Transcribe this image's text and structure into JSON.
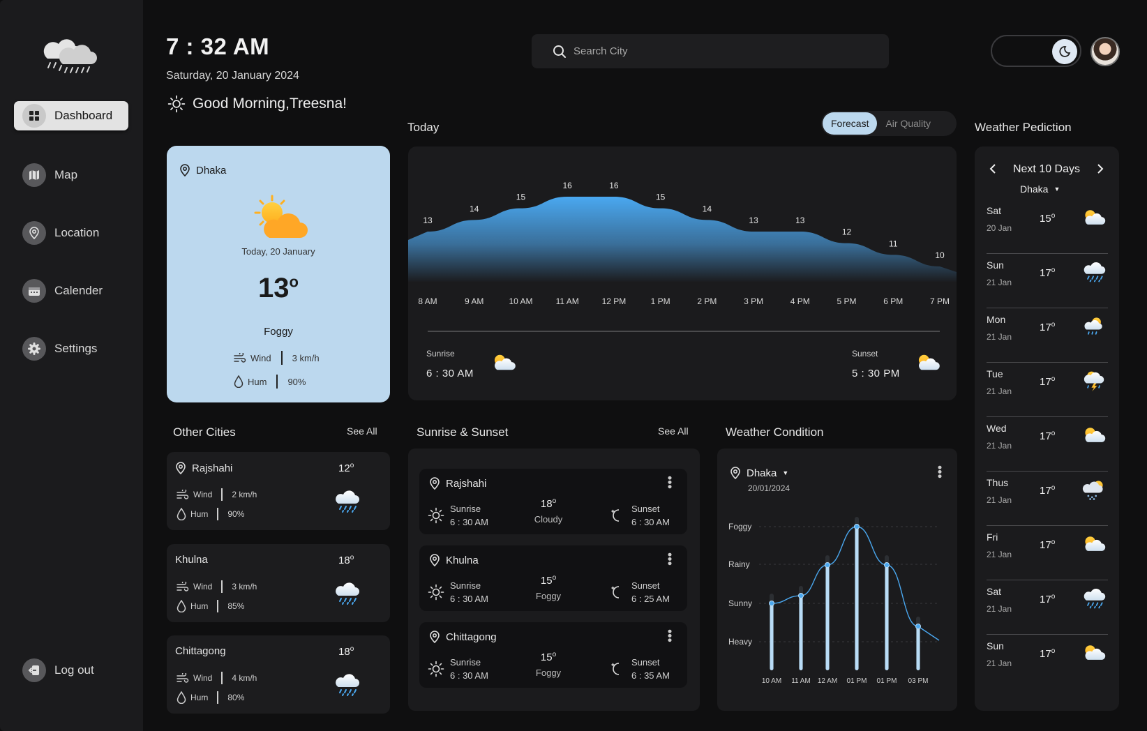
{
  "header": {
    "time": "7 : 32 AM",
    "date": "Saturday, 20 January 2024",
    "greeting": "Good Morning,Treesna!",
    "search_placeholder": "Search City"
  },
  "sidebar": {
    "items": [
      {
        "label": "Dashboard",
        "icon": "dashboard-icon",
        "active": true
      },
      {
        "label": "Map",
        "icon": "map-icon"
      },
      {
        "label": "Location",
        "icon": "location-icon"
      },
      {
        "label": "Calender",
        "icon": "calendar-icon"
      },
      {
        "label": "Settings",
        "icon": "settings-icon"
      }
    ],
    "logout": "Log out"
  },
  "current": {
    "city": "Dhaka",
    "day": "Today, 20 January",
    "temp": "13",
    "condition": "Foggy",
    "wind_label": "Wind",
    "wind": "3 km/h",
    "hum_label": "Hum",
    "hum": "90%"
  },
  "today": {
    "title": "Today",
    "tabs": [
      "Forecast",
      "Air Quality"
    ],
    "sunrise_label": "Sunrise",
    "sunrise": "6 : 30 AM",
    "sunset_label": "Sunset",
    "sunset": "5 : 30 PM"
  },
  "chart_data": [
    {
      "type": "area",
      "title": "Today",
      "x": [
        "8 AM",
        "9 AM",
        "10 AM",
        "11 AM",
        "12 PM",
        "1 PM",
        "2 PM",
        "3 PM",
        "4 PM",
        "5 PM",
        "6 PM",
        "7 PM"
      ],
      "value_labels": [
        13,
        14,
        15,
        16,
        16,
        15,
        14,
        13,
        13,
        12,
        11,
        10
      ]
    },
    {
      "type": "line",
      "title": "Weather Condition",
      "x": [
        "10 AM",
        "11 AM",
        "12 AM",
        "01 PM",
        "01 PM",
        "03 PM"
      ],
      "y_categories": [
        "Heavy",
        "Sunny",
        "Rainy",
        "Foggy"
      ],
      "values": [
        1.0,
        1.2,
        2.0,
        3.0,
        2.0,
        0.4
      ]
    }
  ],
  "other_cities": {
    "title": "Other Cities",
    "see_all": "See All",
    "items": [
      {
        "name": "Rajshahi",
        "temp": "12",
        "wind": "2 km/h",
        "hum": "90%"
      },
      {
        "name": "Khulna",
        "temp": "18",
        "wind": "3 km/h",
        "hum": "85%"
      },
      {
        "name": "Chittagong",
        "temp": "18",
        "wind": "4 km/h",
        "hum": "80%"
      }
    ],
    "wind_label": "Wind",
    "hum_label": "Hum"
  },
  "sun_times": {
    "title": "Sunrise & Sunset",
    "see_all": "See All",
    "sunrise_label": "Sunrise",
    "sunset_label": "Sunset",
    "items": [
      {
        "name": "Rajshahi",
        "temp": "18",
        "cond": "Cloudy",
        "sunrise": "6 : 30 AM",
        "sunset": "6 : 30 AM"
      },
      {
        "name": "Khulna",
        "temp": "15",
        "cond": "Foggy",
        "sunrise": "6 : 30 AM",
        "sunset": "6 : 25 AM"
      },
      {
        "name": "Chittagong",
        "temp": "15",
        "cond": "Foggy",
        "sunrise": "6 : 30 AM",
        "sunset": "6 : 35 AM"
      }
    ]
  },
  "condition": {
    "title": "Weather Condition",
    "city": "Dhaka",
    "date": "20/01/2024"
  },
  "prediction": {
    "title": "Weather Pediction",
    "range": "Next 10 Days",
    "city": "Dhaka",
    "days": [
      {
        "day": "Sat",
        "date": "20 Jan",
        "temp": "15",
        "icon": "cloud-sun-icon"
      },
      {
        "day": "Sun",
        "date": "21 Jan",
        "temp": "17",
        "icon": "cloud-rain-icon"
      },
      {
        "day": "Mon",
        "date": "21 Jan",
        "temp": "17",
        "icon": "sun-rain-icon"
      },
      {
        "day": "Tue",
        "date": "21 Jan",
        "temp": "17",
        "icon": "storm-icon"
      },
      {
        "day": "Wed",
        "date": "21 Jan",
        "temp": "17",
        "icon": "cloud-sun-icon"
      },
      {
        "day": "Thus",
        "date": "21 Jan",
        "temp": "17",
        "icon": "sun-snow-icon"
      },
      {
        "day": "Fri",
        "date": "21 Jan",
        "temp": "17",
        "icon": "cloud-sun-icon"
      },
      {
        "day": "Sat",
        "date": "21 Jan",
        "temp": "17",
        "icon": "cloud-rain-icon"
      },
      {
        "day": "Sun",
        "date": "21 Jan",
        "temp": "17",
        "icon": "cloud-sun-icon"
      }
    ]
  },
  "colors": {
    "accent": "#bcd8ee",
    "chart_blue": "#4aa8f0",
    "background": "#0f0f10",
    "panel": "#1b1b1d"
  }
}
